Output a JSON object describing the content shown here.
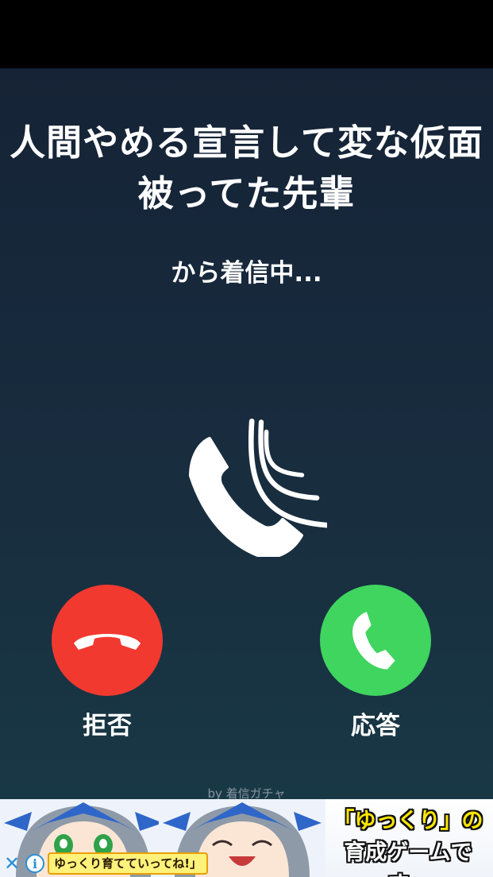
{
  "call": {
    "caller_name": "人間やめる宣言して変な仮面被ってた先輩",
    "status": "から着信中...",
    "decline_label": "拒否",
    "answer_label": "応答",
    "credit": "by 着信ガチャ",
    "icons": {
      "ringing": "phone-ringing-icon",
      "decline": "phone-hangup-icon",
      "answer": "phone-answer-icon"
    },
    "colors": {
      "decline": "#f2392f",
      "answer": "#3fd55f",
      "background_top": "#162336",
      "background_bottom": "#193845"
    }
  },
  "ad": {
    "headline_line1": "「ゆっくり」の",
    "headline_line2": "育成ゲームです。",
    "caption": "ゆっくり育てていってね!」",
    "close_icon": "close-icon",
    "info_icon": "info-icon",
    "close_glyph": "✕",
    "info_glyph": "i"
  }
}
